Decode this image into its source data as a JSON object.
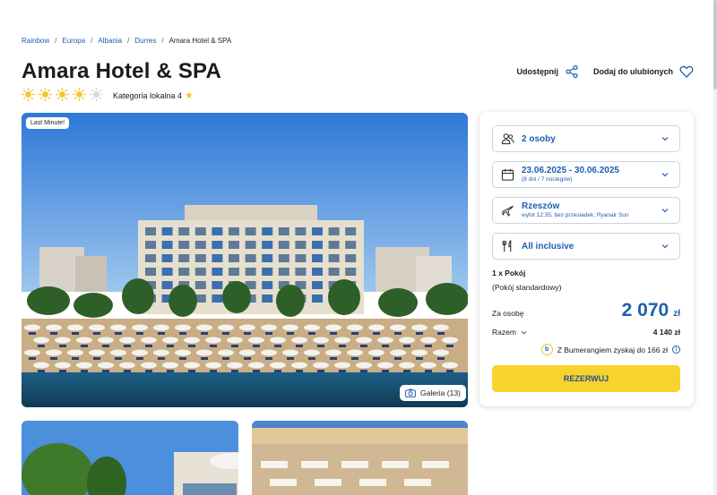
{
  "breadcrumb": [
    {
      "label": "Rainbow"
    },
    {
      "label": "Europa"
    },
    {
      "label": "Albania"
    },
    {
      "label": "Durres"
    }
  ],
  "breadcrumb_current": "Amara Hotel & SPA",
  "breadcrumb_separator": "/",
  "hotel": {
    "name": "Amara Hotel & SPA",
    "sun_rating": 4,
    "sun_max": 5,
    "local_category_label": "Kategoria lokalna 4",
    "local_category_star": "★"
  },
  "actions": {
    "share": "Udostępnij",
    "favorite": "Dodaj do ulubionych"
  },
  "gallery": {
    "badge": "Last Minute!",
    "button": "Galeria (13)"
  },
  "booking": {
    "people": "2 osoby",
    "dates": "23.06.2025 - 30.06.2025",
    "dates_sub": "(8 dni / 7 noclegów)",
    "departure": "Rzeszów",
    "departure_sub": "wylot 12:35, bez przesiadek, Ryanair Sun",
    "board": "All inclusive",
    "room_title": "1 x Pokój",
    "room_sub": "(Pokój standardowy)",
    "per_person_label": "Za osobę",
    "price_amount": "2 070",
    "price_currency": "zł",
    "total_label": "Razem",
    "total_value": "4 140 zł",
    "bumerang_text": "Z Bumerangiem zyskaj do 166 zł",
    "bumerang_logo": "b",
    "info_mark": "i",
    "reserve_button": "REZERWUJ"
  },
  "colors": {
    "accent_blue": "#1e5fb0",
    "button_yellow": "#f7d32e",
    "sun_yellow": "#f5c531"
  }
}
